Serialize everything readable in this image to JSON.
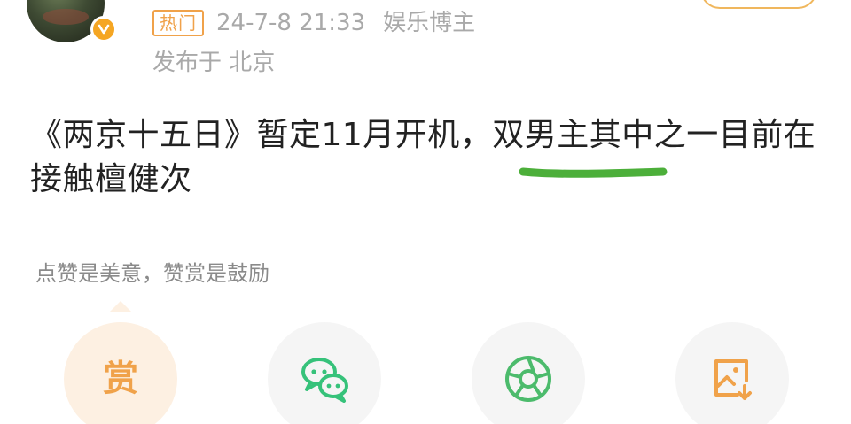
{
  "post": {
    "badge": "热门",
    "time": "24-7-8 21:33",
    "author_tag": "娱乐博主",
    "location": "发布于 北京",
    "text": "《两京十五日》暂定11月开机，双男主其中之一目前在接触檀健次"
  },
  "reward": {
    "hint": "点赞是美意，赞赏是鼓励",
    "button_label": "赏"
  },
  "colors": {
    "accent": "#f0a24a",
    "wechat_green": "#36c27a",
    "moments_green": "#4cbb6c",
    "highlight_green": "#4caf3a",
    "meta_gray": "#a9a9a9"
  },
  "icons": {
    "verified": "verified-v-icon",
    "wechat": "wechat-icon",
    "moments": "moments-shutter-icon",
    "save_image": "save-image-icon"
  }
}
